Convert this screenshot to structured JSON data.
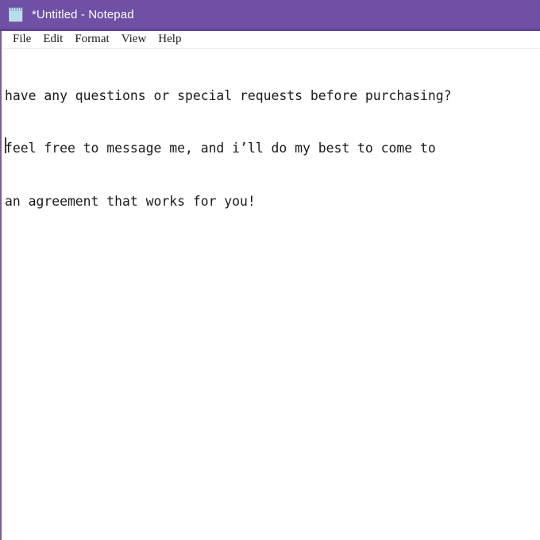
{
  "window": {
    "title": "*Untitled - Notepad",
    "icon": "notepad-icon",
    "titlebar_color": "#7050a5",
    "titlebar_accent_color": "#5e3f96",
    "border_color": "#7b5aa6"
  },
  "menu": {
    "items": [
      {
        "label": "File"
      },
      {
        "label": "Edit"
      },
      {
        "label": "Format"
      },
      {
        "label": "View"
      },
      {
        "label": "Help"
      }
    ]
  },
  "editor": {
    "lines": [
      "have any questions or special requests before purchasing?",
      "feel free to message me, and i’ll do my best to come to",
      "an agreement that works for you!"
    ],
    "text_color": "#1a1a1a",
    "background_color": "#ffffff",
    "caret_line": 3,
    "caret_column": 1
  }
}
